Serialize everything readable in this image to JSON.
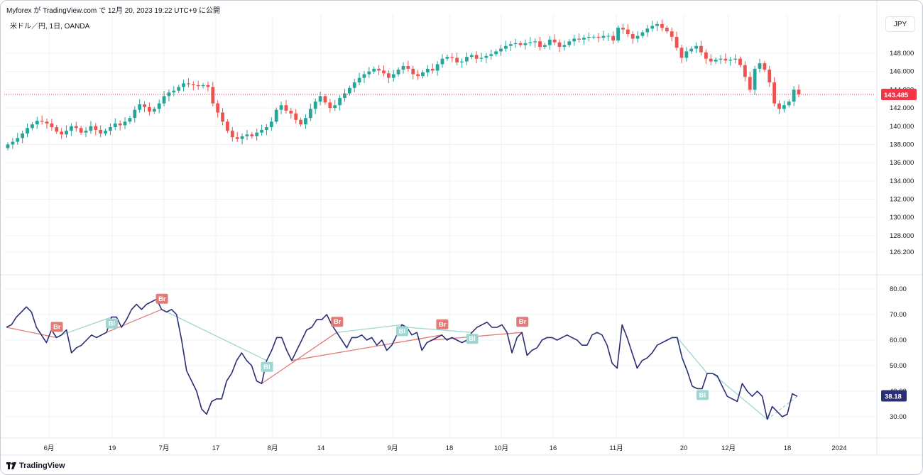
{
  "header": {
    "text": "Myforex が TradingView.com で 12月 20, 2023 19:22 UTC+9 に公開"
  },
  "symbol": {
    "text": "米ドル／円, 1日, OANDA"
  },
  "currency_button": {
    "label": "JPY"
  },
  "price_panel": {
    "y_ticks": [
      "148.000",
      "146.000",
      "144.000",
      "142.000",
      "140.000",
      "138.000",
      "136.000",
      "134.000",
      "132.000",
      "130.000",
      "128.000",
      "126.200"
    ],
    "last_price_label": "143.485",
    "colors": {
      "up": "#26a69a",
      "down": "#ef5350",
      "last_price": "#f23645"
    }
  },
  "indicator_panel": {
    "y_ticks": [
      "80.00",
      "70.00",
      "60.00",
      "50.00",
      "40.00",
      "30.00"
    ],
    "last_value_label": "38.18",
    "line_color": "#2a2e74",
    "bull_tag_color": "#9fd6d2",
    "bear_tag_color": "#e07b78",
    "bear_label": "Br",
    "bull_label": "Bl"
  },
  "x_axis": {
    "labels": [
      "6月",
      "19",
      "7月",
      "17",
      "8月",
      "14",
      "9月",
      "18",
      "10月",
      "16",
      "11月",
      "20",
      "12月",
      "18",
      "2024"
    ]
  },
  "footer": {
    "logo_text": "TradingView"
  },
  "chart_data": [
    {
      "type": "candlestick",
      "title": "米ドル／円, 1日, OANDA",
      "ylabel": "JPY",
      "ylim": [
        126.2,
        149.5
      ],
      "close_series": [
        138.0,
        138.3,
        138.7,
        139.2,
        139.8,
        140.2,
        140.6,
        140.5,
        140.3,
        139.9,
        139.4,
        139.1,
        139.5,
        140.0,
        139.8,
        139.3,
        139.5,
        140.0,
        139.6,
        139.2,
        139.5,
        139.9,
        140.3,
        140.1,
        140.5,
        140.9,
        141.8,
        142.4,
        142.1,
        141.6,
        141.9,
        142.5,
        143.3,
        143.7,
        143.9,
        144.3,
        144.7,
        144.6,
        144.5,
        144.4,
        144.5,
        144.3,
        142.5,
        141.5,
        140.5,
        139.5,
        138.8,
        138.6,
        138.9,
        139.1,
        138.9,
        139.3,
        139.6,
        139.9,
        140.5,
        141.8,
        142.3,
        141.7,
        141.4,
        140.7,
        140.2,
        140.9,
        141.9,
        142.7,
        143.3,
        142.6,
        142.0,
        142.3,
        143.1,
        143.6,
        144.2,
        144.8,
        145.3,
        145.7,
        146.0,
        146.3,
        146.1,
        145.8,
        145.3,
        145.7,
        146.2,
        146.6,
        146.3,
        145.7,
        145.5,
        145.9,
        146.3,
        146.1,
        146.8,
        147.4,
        147.6,
        147.5,
        147.0,
        147.1,
        147.6,
        147.8,
        147.4,
        147.5,
        147.7,
        147.9,
        148.2,
        148.5,
        148.8,
        149.0,
        149.1,
        148.9,
        149.1,
        149.2,
        149.3,
        148.7,
        148.9,
        149.5,
        149.2,
        148.7,
        148.9,
        149.3,
        149.6,
        149.5,
        149.7,
        149.8,
        149.8,
        149.7,
        149.9,
        149.9,
        149.4,
        150.8,
        150.6,
        150.1,
        149.6,
        149.9,
        150.3,
        150.7,
        151.0,
        151.2,
        150.8,
        150.4,
        149.8,
        148.6,
        147.5,
        148.2,
        148.5,
        148.8,
        148.1,
        147.4,
        147.1,
        147.3,
        147.4,
        147.2,
        147.3,
        147.4,
        146.7,
        145.4,
        144.0,
        146.3,
        146.9,
        146.2,
        144.8,
        142.5,
        141.9,
        142.3,
        142.7,
        144.0,
        143.5
      ]
    },
    {
      "type": "line",
      "title": "RSI divergence",
      "ylim": [
        26,
        84
      ],
      "values": [
        65,
        66,
        69,
        71,
        73,
        71,
        65,
        62,
        59,
        64,
        61,
        62,
        64,
        55,
        57,
        58,
        60,
        62,
        61,
        62,
        63,
        69,
        69,
        65,
        68,
        72,
        74,
        72,
        74,
        75,
        76,
        72,
        71,
        72,
        70,
        60,
        48,
        44,
        40,
        33,
        31,
        36,
        37,
        37,
        44,
        47,
        52,
        55,
        52,
        50,
        44,
        43,
        52,
        56,
        61,
        61,
        56,
        52,
        56,
        60,
        64,
        65,
        68,
        68,
        70,
        66,
        63,
        60,
        57,
        61,
        61,
        62,
        60,
        61,
        58,
        60,
        56,
        58,
        62,
        66,
        65,
        62,
        63,
        56,
        59,
        60,
        61,
        62,
        60,
        61,
        60,
        59,
        60,
        63,
        65,
        66,
        67,
        65,
        65,
        66,
        63,
        55,
        61,
        63,
        54,
        56,
        57,
        60,
        61,
        61,
        60,
        61,
        62,
        61,
        60,
        58,
        58,
        62,
        63,
        62,
        58,
        51,
        49,
        66,
        61,
        55,
        49,
        52,
        53,
        55,
        58,
        59,
        60,
        61,
        61,
        53,
        48,
        42,
        41,
        41,
        47,
        47,
        46,
        42,
        38,
        37,
        36,
        43,
        40,
        38,
        40,
        38,
        29,
        34,
        32,
        30,
        31,
        39,
        38
      ]
    }
  ]
}
